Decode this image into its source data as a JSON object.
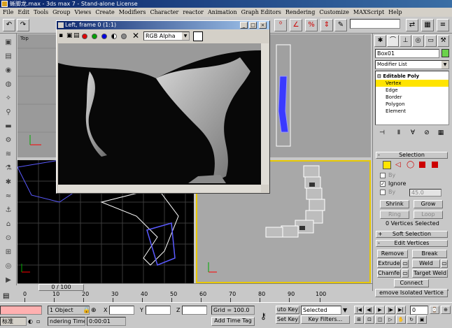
{
  "window": {
    "title": "蜥脚龙.max - 3ds max 7 - Stand-alone License"
  },
  "menu": [
    "File",
    "Edit",
    "Tools",
    "Group",
    "Views",
    "Create",
    "Modifiers",
    "Character",
    "reactor",
    "Animation",
    "Graph Editors",
    "Rendering",
    "Customize",
    "MAXScript",
    "Help"
  ],
  "viewports": {
    "top_label": "Top"
  },
  "frame_buffer": {
    "title": "Left, frame 0 (1:1)",
    "channel": "RGB Alpha"
  },
  "command_panel": {
    "object_name": "Box01",
    "modifier_list": "Modifier List",
    "stack": [
      "Editable Poly",
      "Vertex",
      "Edge",
      "Border",
      "Polygon",
      "Element"
    ],
    "selection": {
      "title": "Selection",
      "by_vertex": "By",
      "ignore": "Ignore",
      "by_angle": "By",
      "angle_value": "45.0",
      "shrink": "Shrink",
      "grow": "Grow",
      "ring": "Ring",
      "loop": "Loop",
      "status": "0 Vertices Selected"
    },
    "soft_selection": "Soft Selection",
    "edit_vertices": {
      "title": "Edit Vertices",
      "remove": "Remove",
      "break": "Break",
      "extrude": "Extrude",
      "weld": "Weld",
      "chamfer": "Chamfer",
      "target_weld": "Target Weld",
      "connect": "Connect",
      "remove_isolated": "emove Isolated Vertice"
    }
  },
  "timeline": {
    "slider": "0 / 100",
    "ticks": [
      "0",
      "10",
      "20",
      "30",
      "40",
      "50",
      "60",
      "70",
      "80",
      "90",
      "100"
    ]
  },
  "status": {
    "objects": "1 Object",
    "x": "X",
    "y": "Y",
    "z": "Z",
    "grid": "Grid = 100.0",
    "auto_key": "uto Key",
    "set_key": "Set Key",
    "selected": "Selected",
    "key_filters": "Key Filters...",
    "rendering_time_label": "ndering Time",
    "rendering_time": "0:00:01",
    "add_time_tag": "Add Time Tag",
    "taskbar": "标准",
    "frame": "0"
  },
  "colors": {
    "highlight": "#ffe400",
    "wire": "#4a4aff",
    "object": "#6ad24a"
  }
}
